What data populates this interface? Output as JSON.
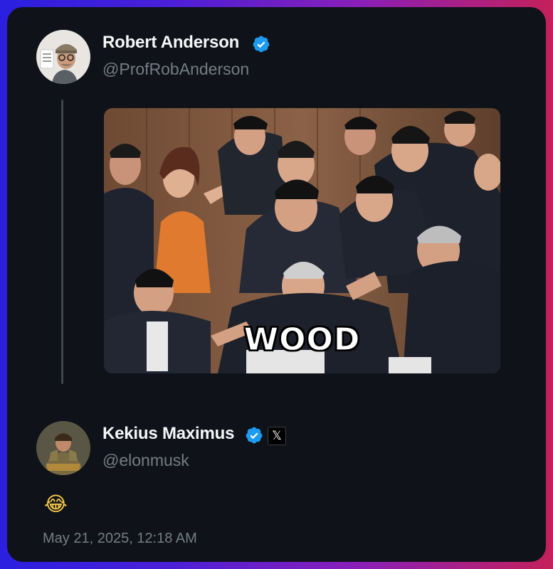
{
  "tweet": {
    "author": {
      "name": "Robert Anderson",
      "handle": "@ProfRobAnderson",
      "verified": true,
      "badge_icon": "verified-badge-icon",
      "badge_color": "#1d9bf0"
    },
    "media": {
      "caption": "WOOD"
    }
  },
  "reply": {
    "author": {
      "name": "Kekius Maximus",
      "handle": "@elonmusk",
      "verified": true,
      "badge_icon": "verified-badge-icon",
      "affiliation_icon": "x-logo-icon",
      "affiliation_glyph": "𝕏"
    },
    "text": "😂",
    "timestamp": "May 21, 2025, 12:18 AM"
  },
  "colors": {
    "background_gradient_start": "#2b1fe0",
    "background_gradient_end": "#c4205a",
    "card": "#0f1319",
    "name_text": "#f5f6f7",
    "secondary_text": "#737c86",
    "thread_line": "#3e444b"
  }
}
